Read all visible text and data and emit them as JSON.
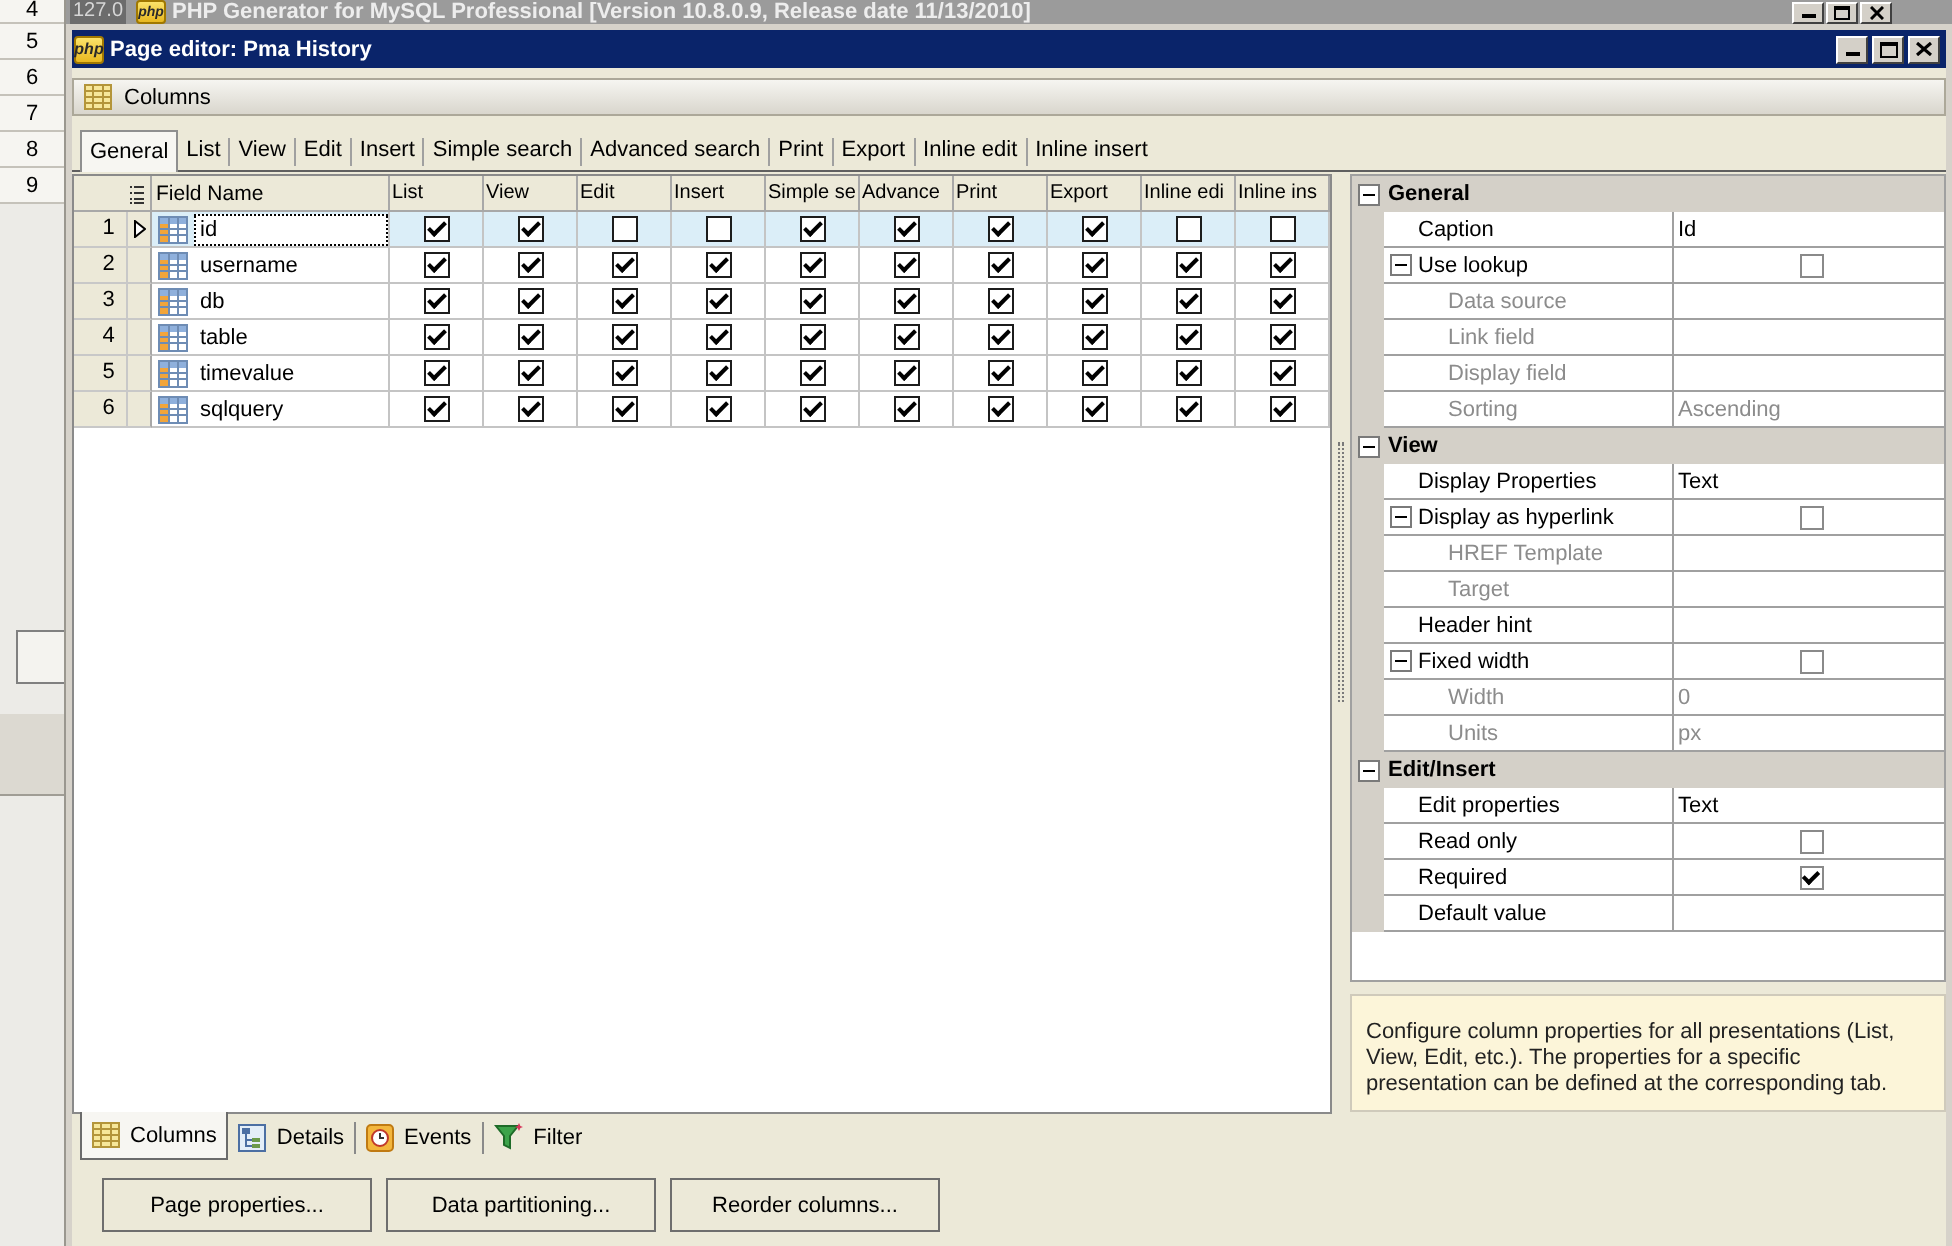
{
  "background_window": {
    "row_numbers": [
      "4",
      "5",
      "6",
      "7",
      "8",
      "9"
    ],
    "fragment": "127.0",
    "logo": "php",
    "title": "PHP Generator for MySQL Professional [Version 10.8.0.9, Release date 11/13/2010]"
  },
  "window": {
    "logo": "php",
    "title": "Page editor: Pma History"
  },
  "section": {
    "title": "Columns"
  },
  "tabs": [
    {
      "label": "General",
      "selected": true
    },
    {
      "label": "List",
      "selected": false
    },
    {
      "label": "View",
      "selected": false
    },
    {
      "label": "Edit",
      "selected": false
    },
    {
      "label": "Insert",
      "selected": false
    },
    {
      "label": "Simple search",
      "selected": false
    },
    {
      "label": "Advanced search",
      "selected": false
    },
    {
      "label": "Print",
      "selected": false
    },
    {
      "label": "Export",
      "selected": false
    },
    {
      "label": "Inline edit",
      "selected": false
    },
    {
      "label": "Inline insert",
      "selected": false
    }
  ],
  "grid": {
    "columns": [
      "Field Name",
      "List",
      "View",
      "Edit",
      "Insert",
      "Simple se",
      "Advance",
      "Print",
      "Export",
      "Inline edi",
      "Inline ins"
    ],
    "rows": [
      {
        "number": "1",
        "name": "id",
        "selected": true,
        "checks": [
          true,
          true,
          false,
          false,
          true,
          true,
          true,
          true,
          false,
          false
        ]
      },
      {
        "number": "2",
        "name": "username",
        "selected": false,
        "checks": [
          true,
          true,
          true,
          true,
          true,
          true,
          true,
          true,
          true,
          true
        ]
      },
      {
        "number": "3",
        "name": "db",
        "selected": false,
        "checks": [
          true,
          true,
          true,
          true,
          true,
          true,
          true,
          true,
          true,
          true
        ]
      },
      {
        "number": "4",
        "name": "table",
        "selected": false,
        "checks": [
          true,
          true,
          true,
          true,
          true,
          true,
          true,
          true,
          true,
          true
        ]
      },
      {
        "number": "5",
        "name": "timevalue",
        "selected": false,
        "checks": [
          true,
          true,
          true,
          true,
          true,
          true,
          true,
          true,
          true,
          true
        ]
      },
      {
        "number": "6",
        "name": "sqlquery",
        "selected": false,
        "checks": [
          true,
          true,
          true,
          true,
          true,
          true,
          true,
          true,
          true,
          true
        ]
      }
    ]
  },
  "properties": [
    {
      "title": "General",
      "expanded": true,
      "items": [
        {
          "name": "Caption",
          "kind": "text",
          "value": "Id",
          "disabled": false
        },
        {
          "name": "Use lookup",
          "kind": "checkbox",
          "checked": false,
          "disabled": false,
          "expanded": true,
          "children": [
            {
              "name": "Data source",
              "kind": "text",
              "disabled": true
            },
            {
              "name": "Link field",
              "kind": "text",
              "disabled": true
            },
            {
              "name": "Display field",
              "kind": "text",
              "disabled": true
            },
            {
              "name": "Sorting",
              "kind": "text",
              "value": "Ascending",
              "disabled": true
            }
          ]
        }
      ]
    },
    {
      "title": "View",
      "expanded": true,
      "items": [
        {
          "name": "Display Properties",
          "kind": "text",
          "value": "Text",
          "disabled": false
        },
        {
          "name": "Display as hyperlink",
          "kind": "checkbox",
          "checked": false,
          "disabled": false,
          "expanded": true,
          "children": [
            {
              "name": "HREF Template",
              "kind": "text",
              "disabled": true
            },
            {
              "name": "Target",
              "kind": "text",
              "disabled": true
            }
          ]
        },
        {
          "name": "Header hint",
          "kind": "text",
          "disabled": false
        },
        {
          "name": "Fixed width",
          "kind": "checkbox",
          "checked": false,
          "disabled": false,
          "expanded": true,
          "children": [
            {
              "name": "Width",
              "kind": "text",
              "value": "0",
              "disabled": true
            },
            {
              "name": "Units",
              "kind": "text",
              "value": "px",
              "disabled": true
            }
          ]
        }
      ]
    },
    {
      "title": "Edit/Insert",
      "expanded": true,
      "items": [
        {
          "name": "Edit properties",
          "kind": "text",
          "value": "Text",
          "disabled": false
        },
        {
          "name": "Read only",
          "kind": "checkbox",
          "checked": false,
          "disabled": false
        },
        {
          "name": "Required",
          "kind": "checkbox",
          "checked": true,
          "disabled": false
        },
        {
          "name": "Default value",
          "kind": "text",
          "disabled": false
        }
      ]
    }
  ],
  "description": "Configure column properties for all presentations (List, View, Edit, etc.). The properties for a specific presentation can be defined at the corresponding tab.",
  "bottom_tabs": [
    {
      "label": "Columns",
      "selected": true
    },
    {
      "label": "Details",
      "selected": false
    },
    {
      "label": "Events",
      "selected": false
    },
    {
      "label": "Filter",
      "selected": false
    }
  ],
  "buttons": [
    "Page properties...",
    "Data partitioning...",
    "Reorder columns..."
  ]
}
